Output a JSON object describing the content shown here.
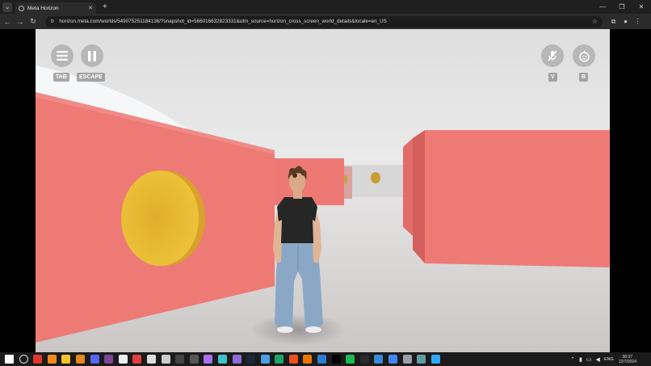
{
  "browser": {
    "tab_title": "Meta Horizon",
    "url": "horizon.meta.com/worlds/549075251184136/?snapshot_id=566016632823331&utm_source=horizon_cross_screen_world_details&locale=en_US"
  },
  "hud": {
    "menu_key": "TAB",
    "pause_key": "ESCAPE",
    "mic_key": "V",
    "emote_key": "B"
  },
  "scene": {
    "colors": {
      "wall": "#ee7a76",
      "wall_dark": "#d9625f",
      "coin": "#e8b92e",
      "floor": "#d6d3d3",
      "sky": "#e6e6e6"
    }
  },
  "taskbar": {
    "icons": [
      "windows-icon",
      "search-icon",
      "opera-icon",
      "firefox-icon",
      "file-explorer-icon",
      "vlc-icon",
      "discord-icon",
      "tor-icon",
      "notion-icon",
      "roblox-icon",
      "unity-icon",
      "unreal-icon",
      "terminal-icon",
      "obs-icon",
      "github-icon",
      "3d-icon",
      "visual-studio-icon",
      "steam-icon",
      "code-icon",
      "excel-icon",
      "figma-icon",
      "blender-icon",
      "vscode-icon",
      "capcut-icon",
      "spotify-icon",
      "epic-icon",
      "sync-icon",
      "chrome-icon",
      "wallet-icon",
      "cloud-icon",
      "photoshop-icon"
    ],
    "language": "ENG",
    "time": "00:37",
    "date": "12/7/2024"
  }
}
